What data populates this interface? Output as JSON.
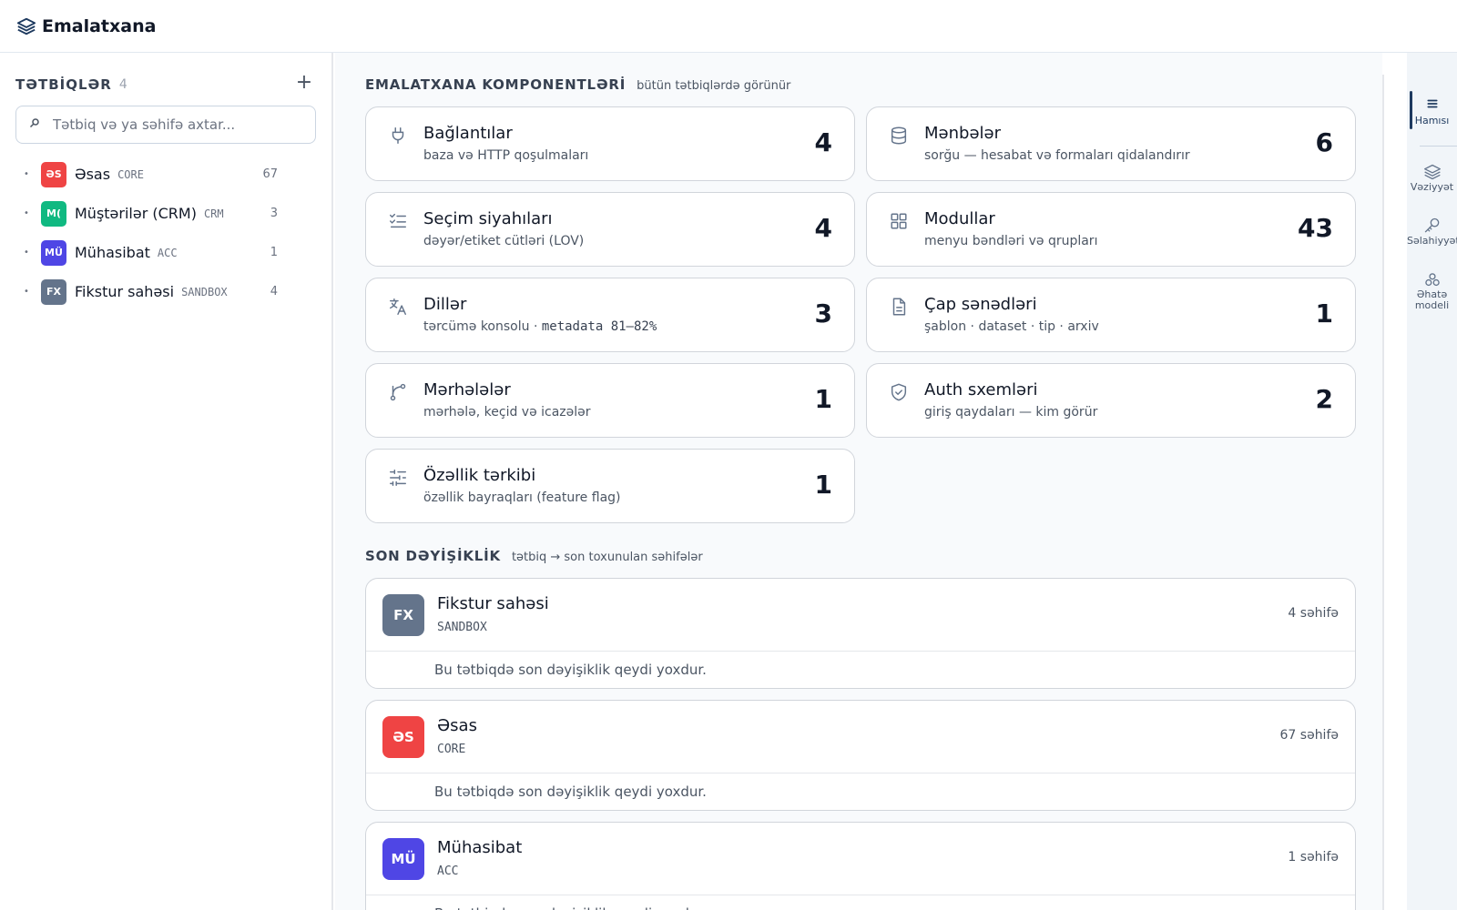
{
  "header": {
    "app_name": "Emalatxana"
  },
  "sidebar": {
    "title": "TƏTBİQLƏR",
    "count": "4",
    "add_label": "+",
    "search_placeholder": "Tətbiq və ya səhifə axtar...",
    "apps": [
      {
        "badge": "ƏS",
        "name": "Əsas",
        "code": "CORE",
        "count": "67",
        "color": "#ef4444"
      },
      {
        "badge": "M(",
        "name": "Müştərilər (CRM)",
        "code": "CRM",
        "count": "3",
        "color": "#10b981"
      },
      {
        "badge": "MÜ",
        "name": "Mühasibat",
        "code": "ACC",
        "count": "1",
        "color": "#4f46e5"
      },
      {
        "badge": "FX",
        "name": "Fikstur sahəsi",
        "code": "SANDBOX",
        "count": "4",
        "color": "#64748b"
      }
    ]
  },
  "components": {
    "title": "EMALATXANA KOMPONENTLƏRİ",
    "subtitle": "bütün tətbiqlərdə görünür",
    "cards": [
      {
        "icon": "plug-icon",
        "title": "Bağlantılar",
        "subtitle": "baza və HTTP qoşulmaları",
        "count": "4"
      },
      {
        "icon": "database-icon",
        "title": "Mənbələr",
        "subtitle": "sorğu — hesabat və formaları qidalandırır",
        "count": "6"
      },
      {
        "icon": "checklist-icon",
        "title": "Seçim siyahıları",
        "subtitle": "dəyər/etiket cütləri (LOV)",
        "count": "4"
      },
      {
        "icon": "grid-icon",
        "title": "Modullar",
        "subtitle": "menyu bəndləri və qrupları",
        "count": "43"
      },
      {
        "icon": "translate-icon",
        "title": "Dillər",
        "subtitle": "tərcümə konsolu · ",
        "subtitle_mono": "metadata 81–82%",
        "count": "3"
      },
      {
        "icon": "document-icon",
        "title": "Çap sənədləri",
        "subtitle": "şablon · dataset · tip · arxiv",
        "count": "1"
      },
      {
        "icon": "workflow-icon",
        "title": "Mərhələlər",
        "subtitle": "mərhələ, keçid və icazələr",
        "count": "1"
      },
      {
        "icon": "shield-check-icon",
        "title": "Auth sxemləri",
        "subtitle": "giriş qaydaları — kim görür",
        "count": "2"
      },
      {
        "icon": "sliders-icon",
        "title": "Özəllik tərkibi",
        "subtitle": "özəllik bayraqları (feature flag)",
        "count": "1"
      }
    ]
  },
  "recent": {
    "title": "SON DƏYİŞİKLİK",
    "subtitle": "tətbiq → son toxunulan səhifələr",
    "items": [
      {
        "badge": "FX",
        "name": "Fikstur sahəsi",
        "code": "SANDBOX",
        "pages": "4 səhifə",
        "note": "Bu tətbiqdə son dəyişiklik qeydi yoxdur.",
        "color": "#64748b"
      },
      {
        "badge": "ƏS",
        "name": "Əsas",
        "code": "CORE",
        "pages": "67 səhifə",
        "note": "Bu tətbiqdə son dəyişiklik qeydi yoxdur.",
        "color": "#ef4444"
      },
      {
        "badge": "MÜ",
        "name": "Mühasibat",
        "code": "ACC",
        "pages": "1 səhifə",
        "note": "Bu tətbiqdə son dəyişiklik qeydi yoxdur.",
        "color": "#4f46e5"
      }
    ]
  },
  "rail": {
    "items": [
      {
        "icon": "list-icon",
        "label": "Hamısı"
      },
      {
        "icon": "layers-icon",
        "label": "Vəziyyət"
      },
      {
        "icon": "key-icon",
        "label": "Səlahiyyət"
      },
      {
        "icon": "model-icon",
        "label": "Əhatə modeli"
      }
    ]
  }
}
